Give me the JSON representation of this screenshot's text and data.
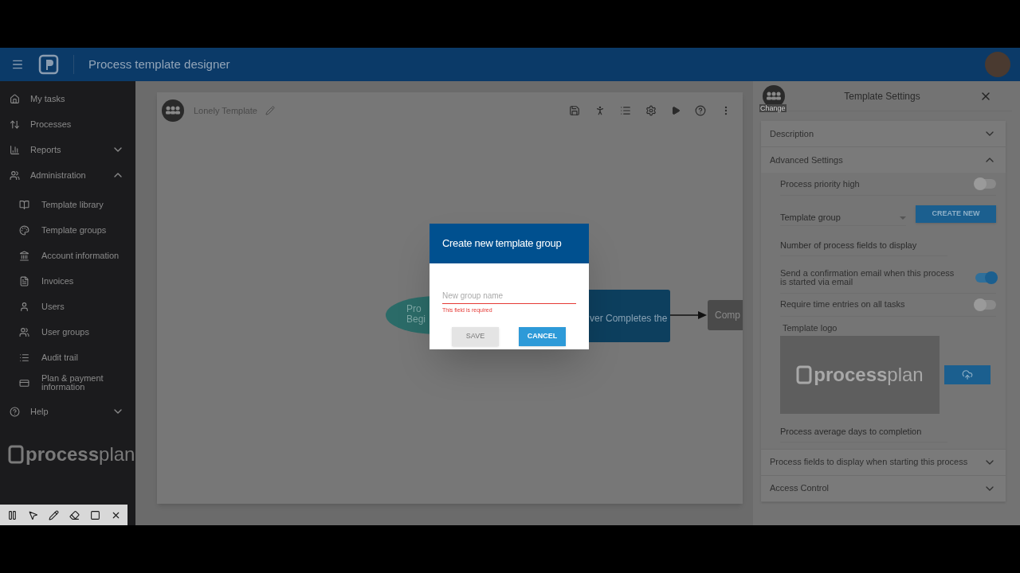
{
  "header": {
    "title": "Process template designer"
  },
  "sidebar": {
    "items": [
      {
        "label": "My tasks"
      },
      {
        "label": "Processes"
      },
      {
        "label": "Reports",
        "kind": "group",
        "expanded": false
      },
      {
        "label": "Administration",
        "kind": "group",
        "expanded": true,
        "children": [
          {
            "label": "Template library"
          },
          {
            "label": "Template groups"
          },
          {
            "label": "Account information"
          },
          {
            "label": "Invoices"
          },
          {
            "label": "Users"
          },
          {
            "label": "User groups"
          },
          {
            "label": "Audit trail"
          },
          {
            "label": "Plan & payment information"
          }
        ]
      },
      {
        "label": "Help",
        "kind": "group",
        "expanded": false
      }
    ],
    "logo": "**process**plan"
  },
  "canvas": {
    "template_name": "Lonely Template",
    "nodes": [
      {
        "kind": "start",
        "lines": [
          "Pro",
          "Begi"
        ]
      },
      {
        "kind": "task",
        "lines": [
          "ver Completes the"
        ]
      },
      {
        "kind": "end",
        "lines": [
          "Comp"
        ]
      }
    ]
  },
  "dialog": {
    "title": "Create new template group",
    "placeholder": "New group name",
    "error": "This field is required",
    "buttons": [
      {
        "label": "SAVE",
        "kind": "save",
        "disabled": true
      },
      {
        "label": "CANCEL",
        "kind": "cancel",
        "disabled": false
      }
    ]
  },
  "settings": {
    "title": "Template Settings",
    "avatar_label": "Change",
    "sections": [
      {
        "title": "Description",
        "expanded": false
      },
      {
        "title": "Advanced Settings",
        "expanded": true,
        "fields": [
          {
            "kind": "toggle",
            "label": "Process priority high",
            "on": false
          },
          {
            "kind": "select",
            "placeholder": "Template group",
            "button": "CREATE NEW"
          },
          {
            "kind": "input",
            "placeholder": "Number of process fields to display"
          },
          {
            "kind": "toggle",
            "label": "Send a confirmation email when this process is started via email",
            "on": true
          },
          {
            "kind": "toggle",
            "label": "Require time entries on all tasks",
            "on": false
          },
          {
            "kind": "logo",
            "label": "Template logo",
            "logo": "**process**plan"
          },
          {
            "kind": "input",
            "placeholder": "Process average days to completion"
          }
        ]
      },
      {
        "title": "Process fields to display when starting this process",
        "expanded": false
      },
      {
        "title": "Access Control",
        "expanded": false
      }
    ]
  }
}
